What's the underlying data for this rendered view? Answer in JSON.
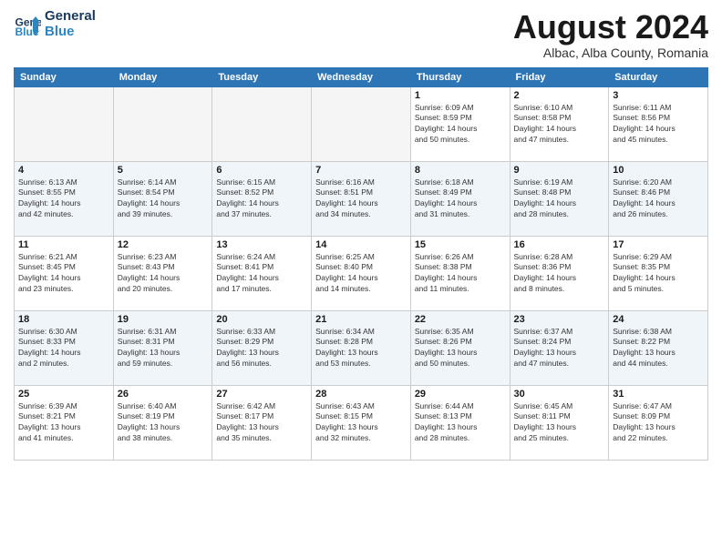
{
  "logo": {
    "line1": "General",
    "line2": "Blue"
  },
  "header": {
    "month": "August 2024",
    "location": "Albac, Alba County, Romania"
  },
  "weekdays": [
    "Sunday",
    "Monday",
    "Tuesday",
    "Wednesday",
    "Thursday",
    "Friday",
    "Saturday"
  ],
  "weeks": [
    [
      {
        "day": "",
        "info": ""
      },
      {
        "day": "",
        "info": ""
      },
      {
        "day": "",
        "info": ""
      },
      {
        "day": "",
        "info": ""
      },
      {
        "day": "1",
        "info": "Sunrise: 6:09 AM\nSunset: 8:59 PM\nDaylight: 14 hours\nand 50 minutes."
      },
      {
        "day": "2",
        "info": "Sunrise: 6:10 AM\nSunset: 8:58 PM\nDaylight: 14 hours\nand 47 minutes."
      },
      {
        "day": "3",
        "info": "Sunrise: 6:11 AM\nSunset: 8:56 PM\nDaylight: 14 hours\nand 45 minutes."
      }
    ],
    [
      {
        "day": "4",
        "info": "Sunrise: 6:13 AM\nSunset: 8:55 PM\nDaylight: 14 hours\nand 42 minutes."
      },
      {
        "day": "5",
        "info": "Sunrise: 6:14 AM\nSunset: 8:54 PM\nDaylight: 14 hours\nand 39 minutes."
      },
      {
        "day": "6",
        "info": "Sunrise: 6:15 AM\nSunset: 8:52 PM\nDaylight: 14 hours\nand 37 minutes."
      },
      {
        "day": "7",
        "info": "Sunrise: 6:16 AM\nSunset: 8:51 PM\nDaylight: 14 hours\nand 34 minutes."
      },
      {
        "day": "8",
        "info": "Sunrise: 6:18 AM\nSunset: 8:49 PM\nDaylight: 14 hours\nand 31 minutes."
      },
      {
        "day": "9",
        "info": "Sunrise: 6:19 AM\nSunset: 8:48 PM\nDaylight: 14 hours\nand 28 minutes."
      },
      {
        "day": "10",
        "info": "Sunrise: 6:20 AM\nSunset: 8:46 PM\nDaylight: 14 hours\nand 26 minutes."
      }
    ],
    [
      {
        "day": "11",
        "info": "Sunrise: 6:21 AM\nSunset: 8:45 PM\nDaylight: 14 hours\nand 23 minutes."
      },
      {
        "day": "12",
        "info": "Sunrise: 6:23 AM\nSunset: 8:43 PM\nDaylight: 14 hours\nand 20 minutes."
      },
      {
        "day": "13",
        "info": "Sunrise: 6:24 AM\nSunset: 8:41 PM\nDaylight: 14 hours\nand 17 minutes."
      },
      {
        "day": "14",
        "info": "Sunrise: 6:25 AM\nSunset: 8:40 PM\nDaylight: 14 hours\nand 14 minutes."
      },
      {
        "day": "15",
        "info": "Sunrise: 6:26 AM\nSunset: 8:38 PM\nDaylight: 14 hours\nand 11 minutes."
      },
      {
        "day": "16",
        "info": "Sunrise: 6:28 AM\nSunset: 8:36 PM\nDaylight: 14 hours\nand 8 minutes."
      },
      {
        "day": "17",
        "info": "Sunrise: 6:29 AM\nSunset: 8:35 PM\nDaylight: 14 hours\nand 5 minutes."
      }
    ],
    [
      {
        "day": "18",
        "info": "Sunrise: 6:30 AM\nSunset: 8:33 PM\nDaylight: 14 hours\nand 2 minutes."
      },
      {
        "day": "19",
        "info": "Sunrise: 6:31 AM\nSunset: 8:31 PM\nDaylight: 13 hours\nand 59 minutes."
      },
      {
        "day": "20",
        "info": "Sunrise: 6:33 AM\nSunset: 8:29 PM\nDaylight: 13 hours\nand 56 minutes."
      },
      {
        "day": "21",
        "info": "Sunrise: 6:34 AM\nSunset: 8:28 PM\nDaylight: 13 hours\nand 53 minutes."
      },
      {
        "day": "22",
        "info": "Sunrise: 6:35 AM\nSunset: 8:26 PM\nDaylight: 13 hours\nand 50 minutes."
      },
      {
        "day": "23",
        "info": "Sunrise: 6:37 AM\nSunset: 8:24 PM\nDaylight: 13 hours\nand 47 minutes."
      },
      {
        "day": "24",
        "info": "Sunrise: 6:38 AM\nSunset: 8:22 PM\nDaylight: 13 hours\nand 44 minutes."
      }
    ],
    [
      {
        "day": "25",
        "info": "Sunrise: 6:39 AM\nSunset: 8:21 PM\nDaylight: 13 hours\nand 41 minutes."
      },
      {
        "day": "26",
        "info": "Sunrise: 6:40 AM\nSunset: 8:19 PM\nDaylight: 13 hours\nand 38 minutes."
      },
      {
        "day": "27",
        "info": "Sunrise: 6:42 AM\nSunset: 8:17 PM\nDaylight: 13 hours\nand 35 minutes."
      },
      {
        "day": "28",
        "info": "Sunrise: 6:43 AM\nSunset: 8:15 PM\nDaylight: 13 hours\nand 32 minutes."
      },
      {
        "day": "29",
        "info": "Sunrise: 6:44 AM\nSunset: 8:13 PM\nDaylight: 13 hours\nand 28 minutes."
      },
      {
        "day": "30",
        "info": "Sunrise: 6:45 AM\nSunset: 8:11 PM\nDaylight: 13 hours\nand 25 minutes."
      },
      {
        "day": "31",
        "info": "Sunrise: 6:47 AM\nSunset: 8:09 PM\nDaylight: 13 hours\nand 22 minutes."
      }
    ]
  ]
}
